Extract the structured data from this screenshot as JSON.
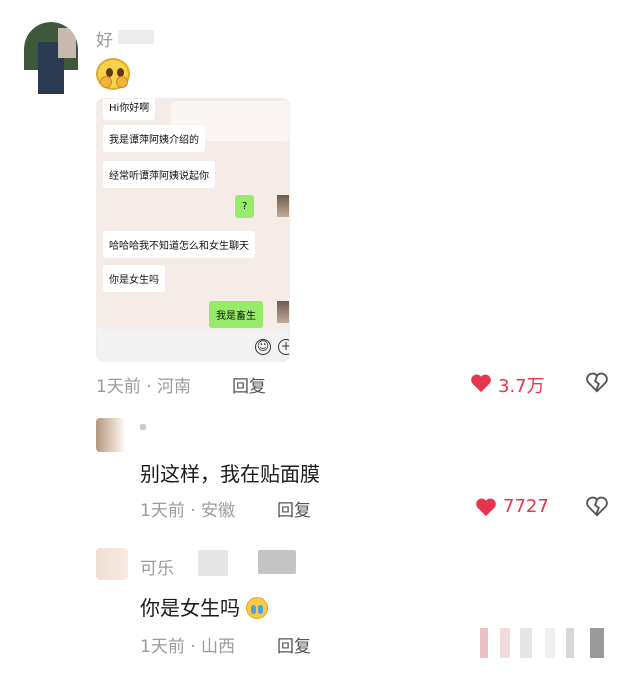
{
  "post": {
    "username": "好",
    "emoji_icon": "pleading-face-icon",
    "screenshot": {
      "messages": [
        {
          "text": "Hi你好啊",
          "side": "left"
        },
        {
          "text": "我是谭萍阿姨介绍的",
          "side": "left"
        },
        {
          "text": "经常听谭萍阿姨说起你",
          "side": "left"
        },
        {
          "text": "?",
          "side": "right"
        },
        {
          "text": "哈哈哈我不知道怎么和女生聊天",
          "side": "left"
        },
        {
          "text": "你是女生吗",
          "side": "left"
        },
        {
          "text": "我是畜生",
          "side": "right"
        }
      ]
    },
    "time": "1天前",
    "location": "河南",
    "reply_label": "回复",
    "likes": "3.7万"
  },
  "replies": [
    {
      "text": "别这样，我在贴面膜",
      "time": "1天前",
      "location": "安徽",
      "reply_label": "回复",
      "likes": "7727"
    },
    {
      "username": "可乐",
      "text": "你是女生吗",
      "time": "1天前",
      "location": "山西",
      "reply_label": "回复"
    }
  ],
  "colors": {
    "like": "#e8344f",
    "wechat_green": "#95ec69",
    "meta": "#9b9b9b"
  }
}
